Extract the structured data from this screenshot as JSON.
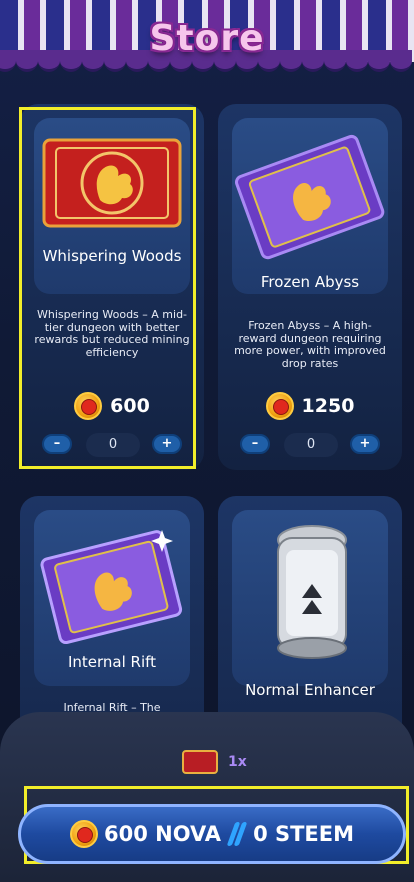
{
  "header": {
    "title": "Store"
  },
  "cards": [
    {
      "name": "Whispering Woods",
      "description": "Whispering Woods – A mid-tier dungeon with better rewards but reduced mining efficiency",
      "price": "600",
      "quantity": "0",
      "art": "red-dragon-ticket"
    },
    {
      "name": "Frozen Abyss",
      "description": "Frozen Abyss – A high-reward dungeon requiring more power, with improved drop rates",
      "price": "1250",
      "quantity": "0",
      "art": "purple-dragon-ticket"
    },
    {
      "name": "Internal Rift",
      "description": "Infernal Rift – The",
      "art": "glowing-purple-ticket"
    },
    {
      "name": "Normal Enhancer",
      "art": "enhancer-canister"
    }
  ],
  "qty_controls": {
    "minus": "–",
    "plus": "+"
  },
  "cart": {
    "count": "1x"
  },
  "buy_button": {
    "nova": "600 NOVA",
    "steem": "0 STEEM"
  },
  "colors": {
    "highlight": "#f2ee2a",
    "accent": "#1f5fa8",
    "title": "#f6c6ec"
  }
}
